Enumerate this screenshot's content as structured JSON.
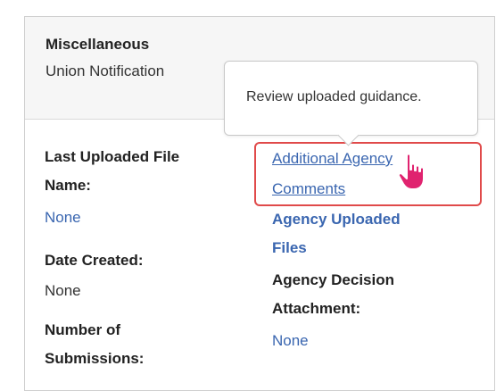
{
  "section": {
    "title": "Miscellaneous",
    "subtitle": "Union Notification"
  },
  "tooltip": {
    "text": "Review uploaded guidance."
  },
  "left_column": {
    "last_uploaded_label_line1": "Last Uploaded File",
    "last_uploaded_label_line2": "Name:",
    "last_uploaded_value": "None",
    "date_created_label": "Date Created:",
    "date_created_value": "None",
    "submissions_label_line1": "Number of",
    "submissions_label_line2": "Submissions:"
  },
  "right_column": {
    "link_line1": "Additional Agency",
    "link_line2": "Comments",
    "agency_uploaded_line1": "Agency Uploaded",
    "agency_uploaded_line2": "Files",
    "decision_label_line1": "Agency Decision",
    "decision_label_line2": "Attachment:",
    "decision_value": "None"
  },
  "colors": {
    "link": "#3a66b0",
    "highlight": "#e04a4a",
    "cursor": "#e0236f"
  }
}
